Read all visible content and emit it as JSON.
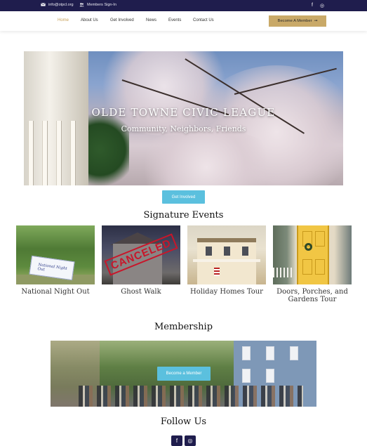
{
  "topbar": {
    "email": "info@otpcl.org",
    "members_signin": "Members Sign-In",
    "email_icon": "envelope-icon",
    "members_icon": "users-icon",
    "social": [
      {
        "icon": "facebook-icon",
        "glyph": "f"
      },
      {
        "icon": "instagram-icon",
        "glyph": "◎"
      }
    ]
  },
  "nav": {
    "items": [
      "Home",
      "About Us",
      "Get Involved",
      "News",
      "Events",
      "Contact Us"
    ],
    "active": "Home",
    "cta_label": "Become A Member",
    "cta_arrow": "➞"
  },
  "hero": {
    "title": "OLDE TOWNE CIVIC LEAGUE",
    "subtitle": "Community, Neighbors, Friends",
    "button_label": "Get Involved"
  },
  "events": {
    "heading": "Signature Events",
    "items": [
      {
        "label": "National Night Out",
        "banner_text": "National Night Out"
      },
      {
        "label": "Ghost Walk",
        "stamp_text": "CANCELED"
      },
      {
        "label": "Holiday Homes Tour"
      },
      {
        "label": "Doors, Porches, and Gardens Tour"
      }
    ]
  },
  "membership": {
    "heading": "Membership",
    "button_label": "Become a Member"
  },
  "follow": {
    "heading": "Follow Us",
    "icons": [
      {
        "icon": "facebook-icon",
        "glyph": "f"
      },
      {
        "icon": "instagram-icon",
        "glyph": "◎"
      }
    ]
  },
  "colors": {
    "topbar": "#1f1d4d",
    "accent_gold": "#c9a968",
    "button_blue": "#5bc0de",
    "nav_active": "#c8a25c"
  }
}
